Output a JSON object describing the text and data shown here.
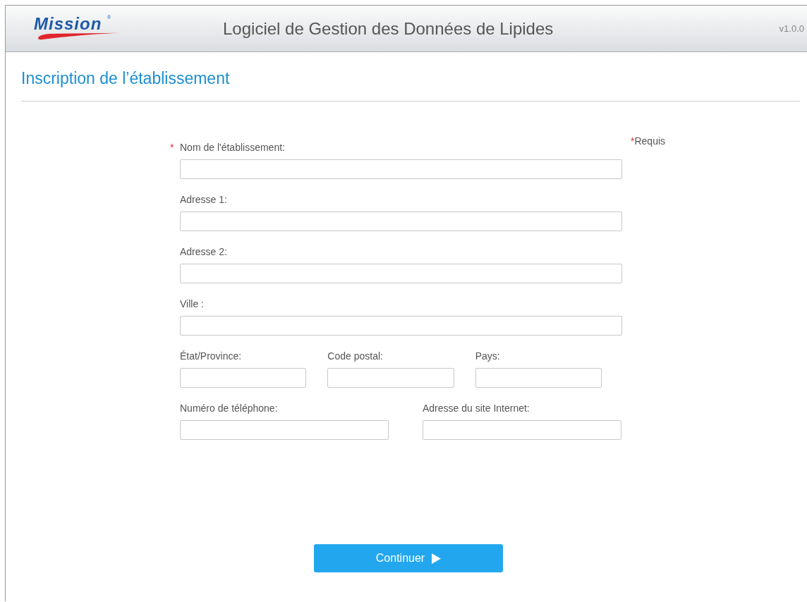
{
  "header": {
    "logo": {
      "text": "Mission",
      "mark": "®"
    },
    "title": "Logiciel de Gestion des Données de Lipides",
    "version": "v1.0.0"
  },
  "page_title": "Inscription de l’établissement",
  "required_note": {
    "marker": "*",
    "text": "Requis"
  },
  "form_rows": [
    [
      {
        "label": "Nom de l'établissement:",
        "marker": "*"
      }
    ],
    [
      {
        "label": "Adresse 1:"
      }
    ],
    [
      {
        "label": "Adresse 2:"
      }
    ],
    [
      {
        "label": "Ville :"
      }
    ],
    [
      {
        "label": "État/Province:"
      },
      {
        "label": "Code postal:"
      },
      {
        "label": "Pays:"
      }
    ],
    [
      {
        "label": "Numéro de téléphone:"
      },
      {
        "label": "Adresse du site Internet:"
      }
    ]
  ],
  "submit_button": {
    "label": "Continuer"
  }
}
